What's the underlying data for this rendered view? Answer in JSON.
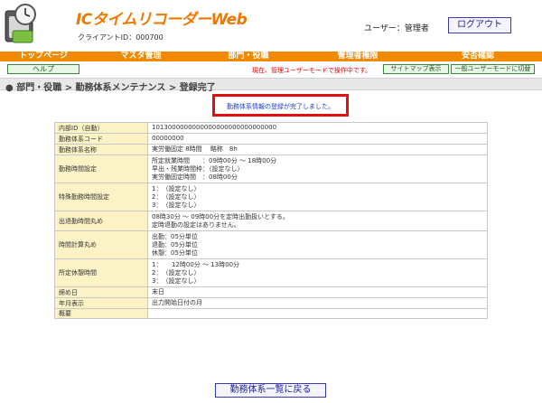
{
  "header": {
    "app_title": "ICタイムリコーダーWeb",
    "client_id": "クライアントID：000700",
    "user_label": "ユーザー：管理者",
    "logout_label": "ログアウト"
  },
  "nav": {
    "items": [
      {
        "label": "トップページ"
      },
      {
        "label": "マスタ管理"
      },
      {
        "label": "部門・役職"
      },
      {
        "label": "管理者権限"
      },
      {
        "label": "安否確認"
      }
    ]
  },
  "subbar": {
    "help_label": "ヘルプ",
    "mode_text": "現在、管理ユーザーモードで操作中です。",
    "sitemap_label": "サイトマップ表示",
    "normal_mode_label": "一般ユーザーモードに切替"
  },
  "breadcrumb": "部門・役職 > 勤務体系メンテナンス > 登録完了",
  "message": "勤務体系情報の登録が完了しました。",
  "details": {
    "rows": [
      {
        "label": "内部ID（自動）",
        "lines": [
          "1013000000000000000000000000000"
        ]
      },
      {
        "label": "勤務体系コード",
        "lines": [
          "00000000"
        ]
      },
      {
        "label": "勤務体系名称",
        "lines": [
          "実労働固定 8時間　 略称　8h"
        ]
      },
      {
        "label": "勤務時間設定",
        "lines": [
          "所定就業時間　　：09時00分 ～ 18時00分",
          "早出・残業時間枠：（設定なし）",
          "実労働固定時間　：08時00分"
        ]
      },
      {
        "label": "特殊勤務時間設定",
        "lines": [
          "1：　（設定なし）",
          "2：　（設定なし）",
          "3：　（設定なし）"
        ]
      },
      {
        "label": "出退勤時間丸め",
        "lines": [
          "08時30分 ～ 09時00分を定時出勤扱いとする。",
          "定時退勤の設定はありません。"
        ]
      },
      {
        "label": "時間計算丸め",
        "lines": [
          "出勤：05分単位",
          "退勤：05分単位",
          "休憩：05分単位"
        ]
      },
      {
        "label": "所定休憩時間",
        "lines": [
          "1：　　12時00分 ～ 13時00分",
          "2：　（設定なし）",
          "3：　（設定なし）"
        ]
      },
      {
        "label": "締め日",
        "lines": [
          "末日"
        ]
      },
      {
        "label": "年月表示",
        "lines": [
          "出力開始日付の月"
        ]
      },
      {
        "label": "概要",
        "lines": [
          ""
        ]
      }
    ]
  },
  "back_label": "勤務体系一覧に戻る",
  "colors": {
    "brand_orange": "#f28a00",
    "title_orange": "#f07800",
    "label_cell_bg": "#fbf3c6",
    "alert_red": "#e01010",
    "message_blue": "#1a3ad0"
  },
  "icons": {
    "logo": "clock-timecard-logo-icon"
  }
}
